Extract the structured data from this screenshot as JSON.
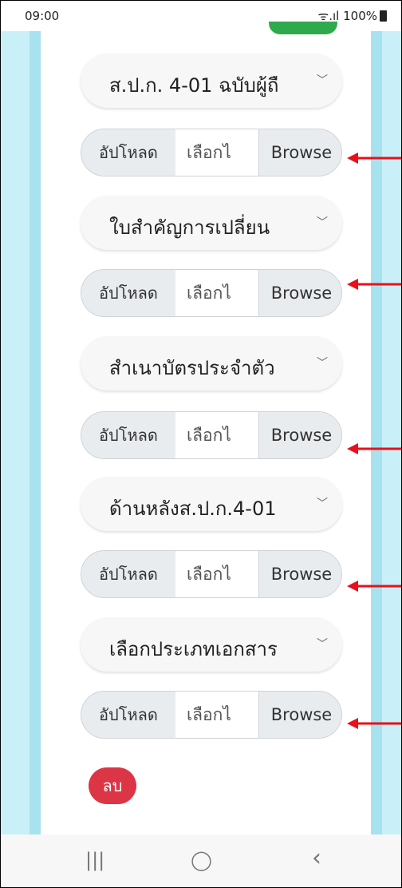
{
  "status": {
    "time": "09:00",
    "signal": "ᯤ.ıl",
    "battery": "100%"
  },
  "rows": [
    {
      "select": "ส.ป.ก. 4-01 ฉบับผู้ถื",
      "upload_label": "อัปโหลด",
      "file_text": "เลือกไ",
      "browse": "Browse"
    },
    {
      "select": "ใบสำคัญการเปลี่ยน",
      "upload_label": "อัปโหลด",
      "file_text": "เลือกไ",
      "browse": "Browse"
    },
    {
      "select": "สำเนาบัตรประจำตัว",
      "upload_label": "อัปโหลด",
      "file_text": "เลือกไ",
      "browse": "Browse"
    },
    {
      "select": "ด้านหลังส.ป.ก.4-01",
      "upload_label": "อัปโหลด",
      "file_text": "เลือกไ",
      "browse": "Browse"
    },
    {
      "select": "เลือกประเภทเอกสาร",
      "upload_label": "อัปโหลด",
      "file_text": "เลือกไ",
      "browse": "Browse"
    }
  ],
  "delete_label": "ลบ",
  "nav": {
    "recent": "|||",
    "home": "◯",
    "back": "‹"
  },
  "colors": {
    "background": "#c9f0f8",
    "delete": "#dc3545",
    "arrow": "#e8101a",
    "accent": "#2eaa4c"
  }
}
